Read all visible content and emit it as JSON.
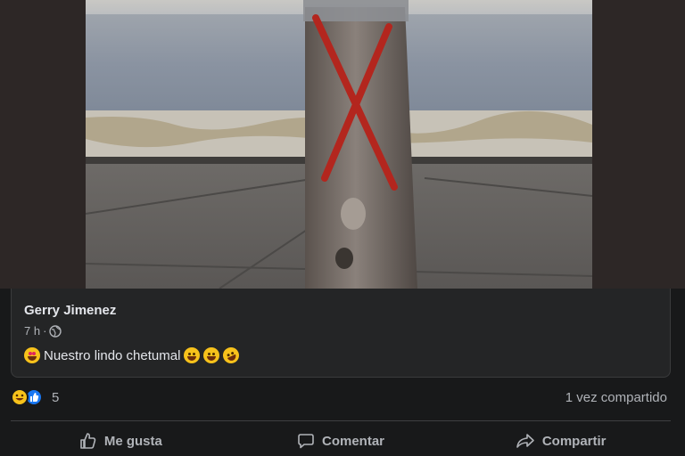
{
  "post": {
    "author": "Gerry Jimenez",
    "time": "7 h",
    "separator": "·",
    "privacy_icon": "globe-icon",
    "caption_text": "Nuestro lindo chetumal"
  },
  "stats": {
    "reaction_count": "5",
    "shares": "1 vez compartido"
  },
  "actions": {
    "like": "Me gusta",
    "comment": "Comentar",
    "share": "Compartir"
  },
  "colors": {
    "background": "#18191a",
    "card": "#242526",
    "text_primary": "#e4e6eb",
    "text_secondary": "#b0b3b8",
    "like_blue": "#1877f2"
  }
}
